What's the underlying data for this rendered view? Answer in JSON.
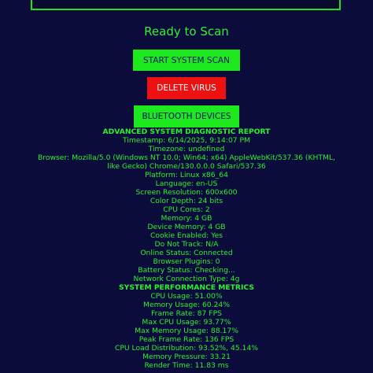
{
  "status": "Ready to Scan",
  "buttons": {
    "scan": "START SYSTEM SCAN",
    "delete": "DELETE VIRUS",
    "bluetooth": "BLUETOOTH DEVICES"
  },
  "colors": {
    "background": "#0c0c3c",
    "accent_green": "#1ee81e",
    "danger_red": "#ee1111",
    "text_green": "#2ef02e"
  },
  "report": {
    "title": "ADVANCED SYSTEM DIAGNOSTIC REPORT",
    "timestamp": "Timestamp: 6/14/2025, 9:14:07 PM",
    "timezone": "Timezone: undefined",
    "browser": "Browser: Mozilla/5.0 (Windows NT 10.0; Win64; x64) AppleWebKit/537.36 (KHTML, like Gecko) Chrome/130.0.0.0 Safari/537.36",
    "platform": "Platform: Linux x86_64",
    "language": "Language: en-US",
    "resolution": "Screen Resolution: 600x600",
    "color_depth": "Color Depth: 24 bits",
    "cpu_cores": "CPU Cores: 2",
    "memory": "Memory: 4 GB",
    "device_memory": "Device Memory: 4 GB",
    "cookies": "Cookie Enabled: Yes",
    "dnt": "Do Not Track: N/A",
    "online": "Online Status: Connected",
    "plugins": "Browser Plugins: 0",
    "battery": "Battery Status: Checking...",
    "network": "Network Connection Type: 4g"
  },
  "metrics": {
    "title": "SYSTEM PERFORMANCE METRICS",
    "cpu_usage": "CPU Usage: 51.00%",
    "memory_usage": "Memory Usage: 60.24%",
    "frame_rate": "Frame Rate: 87 FPS",
    "max_cpu": "Max CPU Usage: 93.77%",
    "max_memory": "Max Memory Usage: 88.17%",
    "peak_frame": "Peak Frame Rate: 136 FPS",
    "cpu_load": "CPU Load Distribution: 93.52%, 45.14%",
    "memory_pressure": "Memory Pressure: 33.21",
    "render_time": "Render Time: 11.83 ms"
  }
}
